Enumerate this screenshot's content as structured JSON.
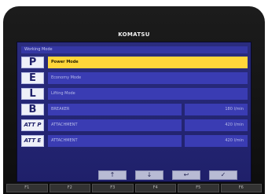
{
  "brand": "KOMATSU",
  "header": {
    "title": "Working Mode"
  },
  "modes": [
    {
      "letter": "P",
      "label": "Power Mode",
      "selected": true
    },
    {
      "letter": "E",
      "label": "Economy Mode",
      "selected": false
    },
    {
      "letter": "L",
      "label": "Lifting Mode",
      "selected": false
    },
    {
      "letter": "B",
      "label": "BREAKER",
      "value": "180 l/min",
      "selected": false
    },
    {
      "letter": "ATT P",
      "label": "ATTACHMENT",
      "value": "420 l/min",
      "selected": false
    },
    {
      "letter": "ATT E",
      "label": "ATTACHMENT",
      "value": "420 l/min",
      "selected": false
    }
  ],
  "buttons": [
    {
      "icon": "up-arrow-icon",
      "glyph": "↑"
    },
    {
      "icon": "down-arrow-icon",
      "glyph": "↓"
    },
    {
      "icon": "return-icon",
      "glyph": "↩"
    },
    {
      "icon": "check-icon",
      "glyph": "✓"
    }
  ],
  "function_keys": [
    "F1",
    "F2",
    "F3",
    "F4",
    "F5",
    "F6"
  ]
}
